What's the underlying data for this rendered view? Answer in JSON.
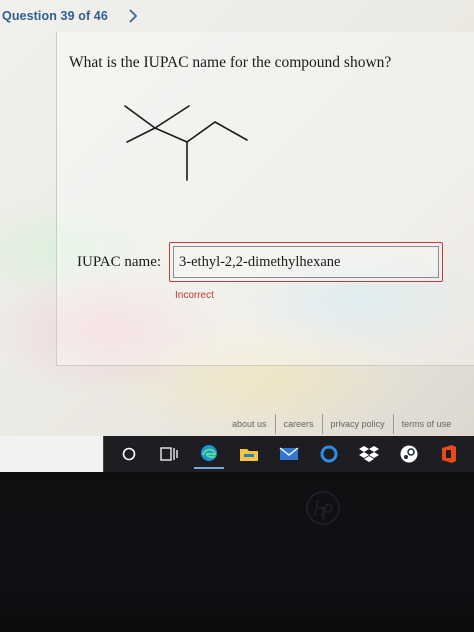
{
  "header": {
    "question_label": "Question 39 of 46"
  },
  "question": {
    "prompt": "What is the IUPAC name for the compound shown?"
  },
  "answer": {
    "label": "IUPAC name:",
    "value": "3-ethyl-2,2-dimethylhexane",
    "feedback": "Incorrect"
  },
  "footer": {
    "links": [
      "about us",
      "careers",
      "privacy policy",
      "terms of use"
    ]
  },
  "taskbar": {
    "icons": [
      "cortana-icon",
      "task-view-icon",
      "edge-icon",
      "file-explorer-icon",
      "mail-icon",
      "cortana-ring-icon",
      "dropbox-icon",
      "steam-icon",
      "office-icon"
    ]
  },
  "colors": {
    "accent": "#2d5f93",
    "error": "#c0392b",
    "box_border": "#c9393c"
  }
}
